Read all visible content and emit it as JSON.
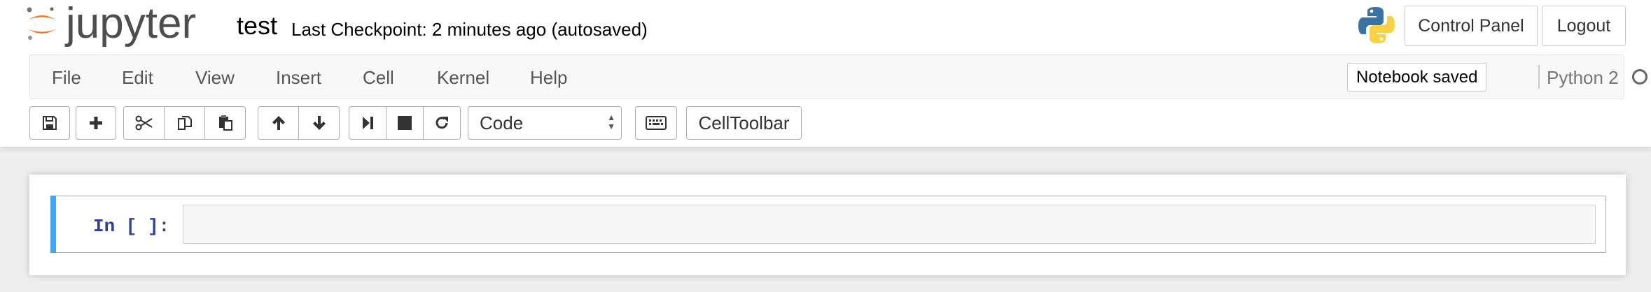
{
  "header": {
    "logo_text": "jupyter",
    "notebook_name": "test",
    "checkpoint_text": "Last Checkpoint: 2 minutes ago (autosaved)",
    "control_panel_label": "Control Panel",
    "logout_label": "Logout",
    "icons": {
      "logo": "jupyter-logo",
      "kernel_logo": "python-logo"
    }
  },
  "menubar": {
    "items": [
      "File",
      "Edit",
      "View",
      "Insert",
      "Cell",
      "Kernel",
      "Help"
    ],
    "notification": "Notebook saved",
    "kernel_name": "Python 2",
    "kernel_status_icon": "kernel-idle-circle-icon"
  },
  "toolbar": {
    "buttons": [
      {
        "name": "save-button",
        "icon": "floppy-disk-icon"
      },
      {
        "name": "insert-cell-below-button",
        "icon": "plus-icon"
      },
      {
        "name": "cut-cells-button",
        "icon": "scissors-icon"
      },
      {
        "name": "copy-cells-button",
        "icon": "copy-icon"
      },
      {
        "name": "paste-cells-button",
        "icon": "paste-icon"
      },
      {
        "name": "move-cells-up-button",
        "icon": "arrow-up-icon"
      },
      {
        "name": "move-cells-down-button",
        "icon": "arrow-down-icon"
      },
      {
        "name": "run-cell-button",
        "icon": "step-forward-icon"
      },
      {
        "name": "interrupt-kernel-button",
        "icon": "stop-icon"
      },
      {
        "name": "restart-kernel-button",
        "icon": "refresh-icon"
      },
      {
        "name": "command-palette-button",
        "icon": "keyboard-icon"
      }
    ],
    "cell_type_selected": "Code",
    "celltoolbar_label": "CellToolbar"
  },
  "notebook": {
    "cells": [
      {
        "prompt": "In [ ]:",
        "source": ""
      }
    ]
  },
  "colors": {
    "selected_cell_bar": "#42a5f5",
    "prompt": "#303f9f",
    "jupyter_orange": "#f37726"
  }
}
